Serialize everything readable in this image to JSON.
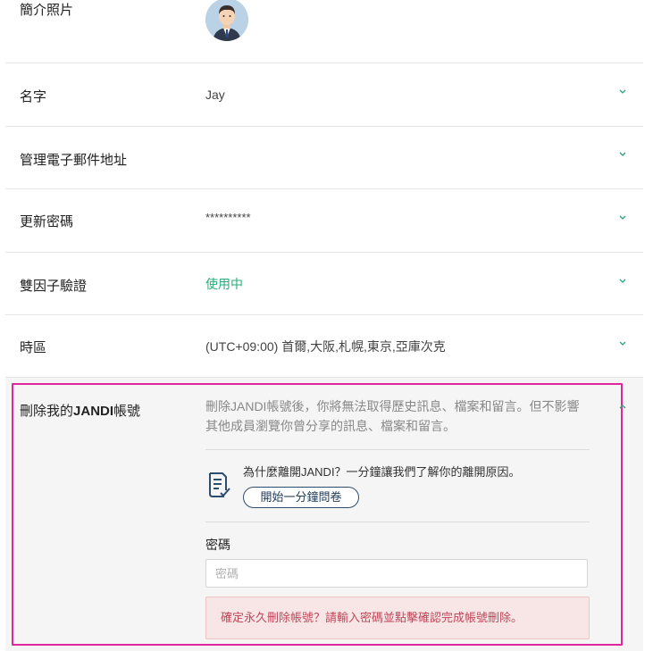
{
  "profile": {
    "photo_label": "簡介照片",
    "name_label": "名字",
    "name_value": "Jay",
    "email_label": "管理電子郵件地址",
    "password_label": "更新密碼",
    "password_value": "**********",
    "twofactor_label": "雙因子驗證",
    "twofactor_value": "使用中",
    "timezone_label": "時區",
    "timezone_value": "(UTC+09:00) 首爾,大阪,札幌,東京,亞庫次克"
  },
  "delete": {
    "label_prefix": "刪除我的",
    "label_brand": "JANDI",
    "label_suffix": "帳號",
    "description": "刪除JANDI帳號後，你將無法取得歷史訊息、檔案和留言。但不影響其他成員瀏覽你曾分享的訊息、檔案和留言。",
    "survey_text": "為什麼離開JANDI？一分鐘讓我們了解你的離開原因。",
    "survey_button": "開始一分鐘問卷",
    "password_label": "密碼",
    "password_placeholder": "密碼",
    "warning": "確定永久刪除帳號？請輸入密碼並點擊確認完成帳號刪除。"
  },
  "icons": {
    "chevron": "chevron-down-icon",
    "chevron_up": "chevron-up-icon",
    "survey": "survey-document-icon"
  },
  "colors": {
    "accent_green": "#27ae7a",
    "highlight": "#e0289a",
    "warning_text": "#c0475a"
  }
}
